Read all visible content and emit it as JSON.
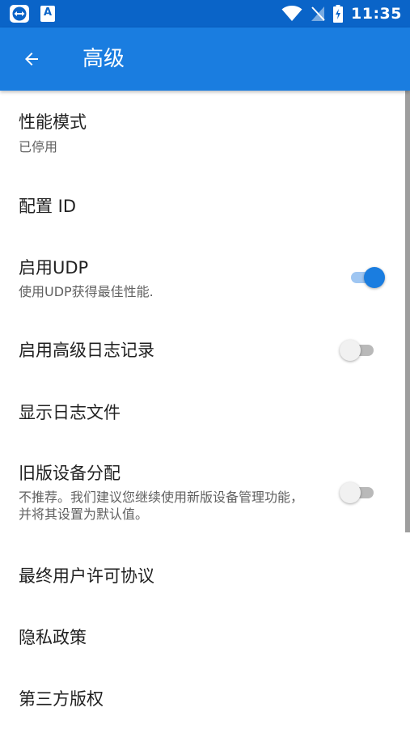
{
  "status_bar": {
    "app_icon": "teamviewer-icon",
    "a_icon_label": "A",
    "wifi_icon": "wifi-icon",
    "signal_icon": "no-sim-signal-icon",
    "battery_icon": "battery-charging-icon",
    "time": "11:35",
    "color": "#0a64c8"
  },
  "app_bar": {
    "back_icon": "arrow-left-icon",
    "title": "高级",
    "color": "#1a7de0"
  },
  "settings": [
    {
      "title": "性能模式",
      "summary": "已停用"
    },
    {
      "title": "配置 ID",
      "summary": ""
    },
    {
      "title": "启用UDP",
      "summary": "使用UDP获得最佳性能.",
      "toggle": "on"
    },
    {
      "title": "启用高级日志记录",
      "summary": "",
      "toggle": "off"
    },
    {
      "title": "显示日志文件",
      "summary": ""
    },
    {
      "title": "旧版设备分配",
      "summary": "不推荐。我们建议您继续使用新版设备管理功能，并将其设置为默认值。",
      "toggle": "off"
    },
    {
      "title": "最终用户许可协议",
      "summary": ""
    },
    {
      "title": "隐私政策",
      "summary": ""
    },
    {
      "title": "第三方版权",
      "summary": ""
    }
  ],
  "accent_color": "#1a7de0"
}
